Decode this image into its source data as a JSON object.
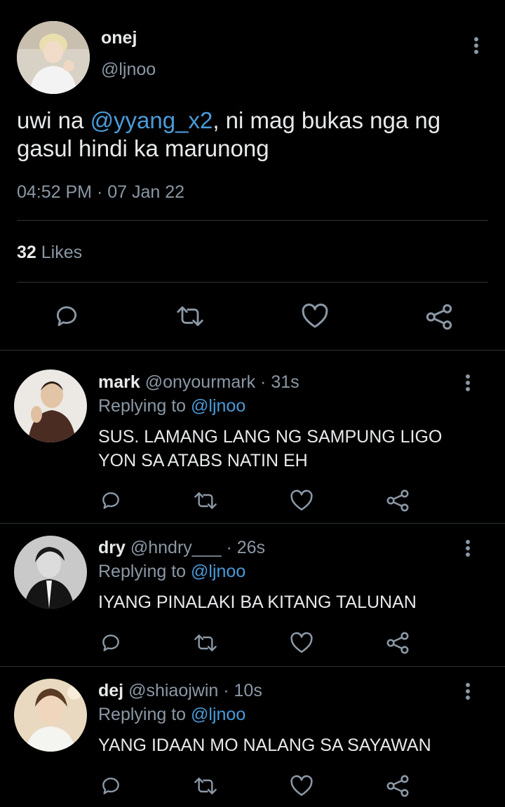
{
  "main_tweet": {
    "display_name": "onej",
    "handle": "@ljnoo",
    "text_before": "uwi na ",
    "mention": "@yyang_x2",
    "text_after": ", ni mag bukas nga ng gasul hindi ka marunong",
    "time": "04:52 PM",
    "sep": "·",
    "date": "07 Jan 22",
    "likes_count": "32",
    "likes_label": "Likes"
  },
  "replies": [
    {
      "display_name": "mark",
      "handle": "@onyourmark",
      "sep": "·",
      "time": "31s",
      "replying_label": "Replying to",
      "replying_to": "@ljnoo",
      "text": "SUS. LAMANG LANG NG SAMPUNG LIGO YON SA ATABS NATIN EH"
    },
    {
      "display_name": "dry",
      "handle": "@hndry___",
      "sep": "·",
      "time": "26s",
      "replying_label": "Replying to",
      "replying_to": "@ljnoo",
      "text": "IYANG PINALAKI BA KITANG TALUNAN"
    },
    {
      "display_name": "dej",
      "handle": "@shiaojwin",
      "sep": "·",
      "time": "10s",
      "replying_label": "Replying to",
      "replying_to": "@ljnoo",
      "text": "YANG IDAAN MO NALANG SA SAYAWAN"
    }
  ],
  "icons": [
    "reply-icon",
    "retweet-icon",
    "like-icon",
    "share-icon",
    "more-icon"
  ],
  "colors": {
    "background": "#000000",
    "text": "#e7e9ea",
    "muted": "#8b98a5",
    "link": "#4a9bd8",
    "divider": "#2f3336"
  }
}
